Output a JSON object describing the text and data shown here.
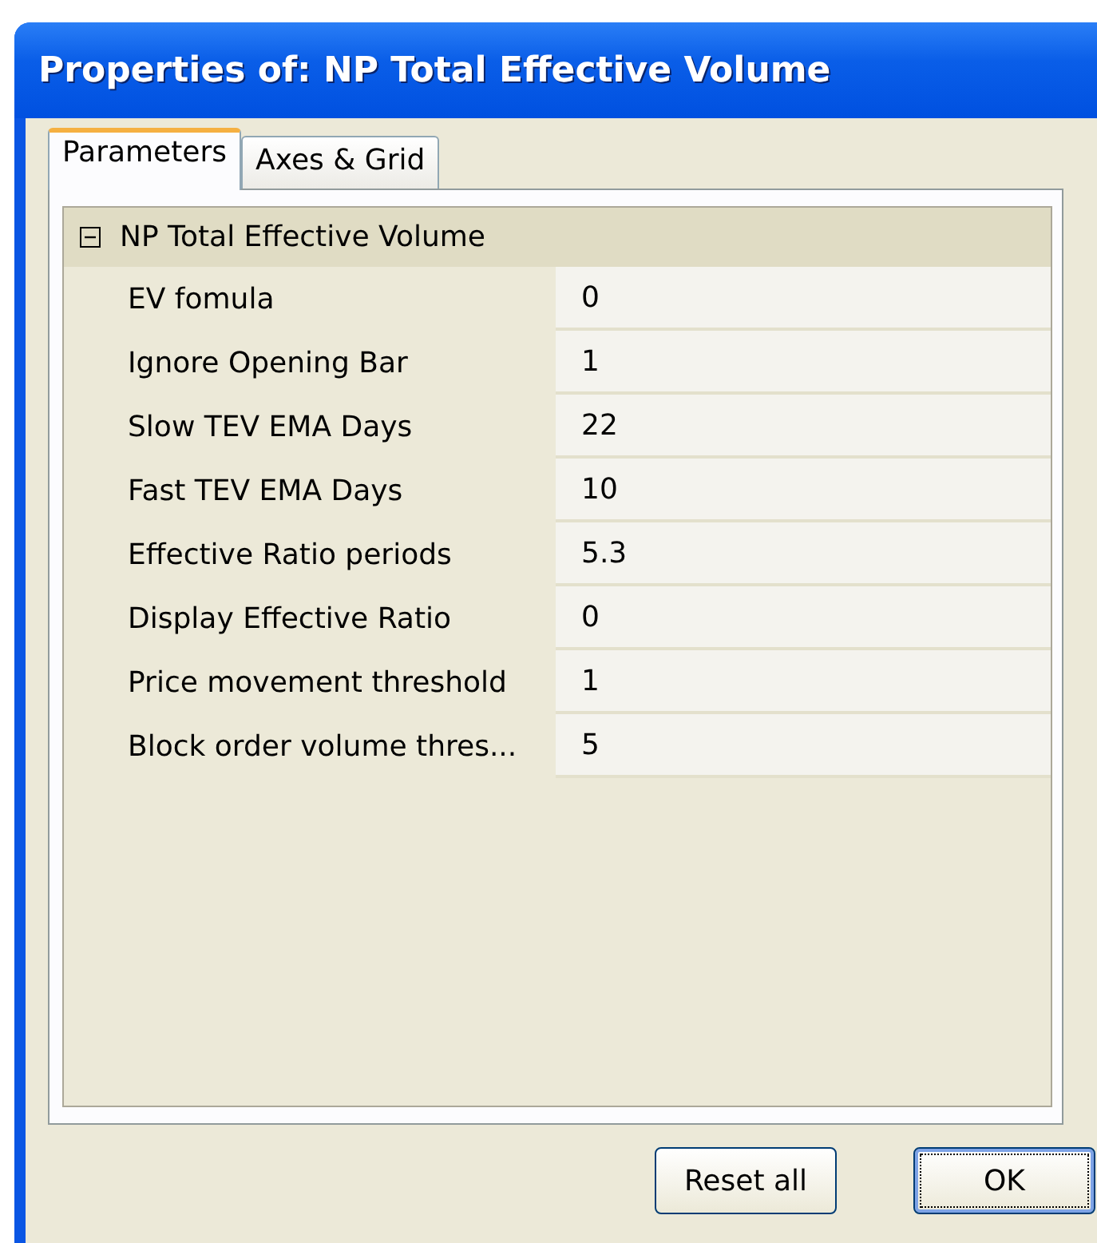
{
  "window": {
    "title": "Properties of: NP Total Effective Volume"
  },
  "tabs": [
    {
      "label": "Parameters",
      "selected": true
    },
    {
      "label": "Axes & Grid",
      "selected": false
    }
  ],
  "category": {
    "name": "NP Total Effective Volume",
    "expanded": true
  },
  "properties": [
    {
      "name": "EV fomula",
      "value": "0"
    },
    {
      "name": "Ignore Opening Bar",
      "value": "1"
    },
    {
      "name": "Slow TEV EMA Days",
      "value": "22"
    },
    {
      "name": "Fast TEV EMA Days",
      "value": "10"
    },
    {
      "name": "Effective Ratio periods",
      "value": "5.3"
    },
    {
      "name": "Display Effective Ratio",
      "value": "0"
    },
    {
      "name": "Price movement threshold",
      "value": "1"
    },
    {
      "name": "Block order volume thres...",
      "value": "5"
    }
  ],
  "buttons": [
    {
      "label": "Reset all",
      "default": false
    },
    {
      "label": "OK",
      "default": true
    }
  ]
}
